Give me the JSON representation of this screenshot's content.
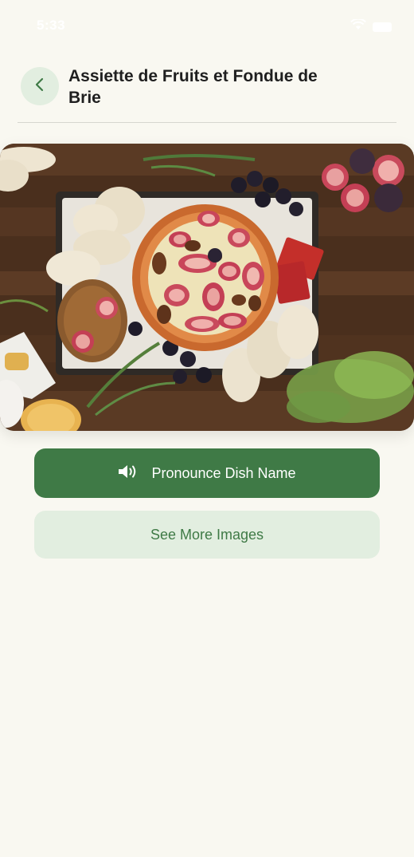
{
  "status_bar": {
    "time": "5:33",
    "wifi_icon": "wifi-icon",
    "battery_icon": "battery-icon"
  },
  "header": {
    "back_icon": "chevron-left-icon",
    "title": "Assiette de Fruits et Fondue de Brie"
  },
  "hero": {
    "image_subject": "baked brie with figs and pecans, bread, grapes, herbs"
  },
  "actions": {
    "pronounce_label": "Pronounce Dish Name",
    "pronounce_icon": "speaker-icon",
    "more_images_label": "See More Images"
  },
  "colors": {
    "background": "#f9f8f1",
    "primary": "#3f7a46",
    "secondary_bg": "#e2eee0"
  }
}
